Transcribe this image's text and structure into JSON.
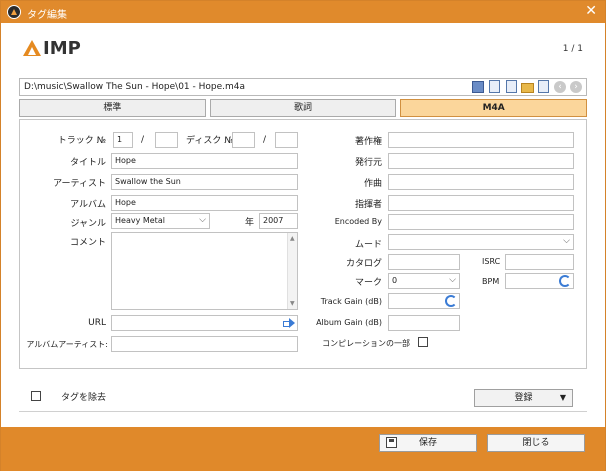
{
  "window": {
    "title": "タグ編集",
    "close_glyph": "✕"
  },
  "header": {
    "logo_text": "IMP",
    "page_count": "1 / 1"
  },
  "path": {
    "value": "D:\\music\\Swallow The Sun - Hope\\01 - Hope.m4a",
    "icons": [
      "tag-icon",
      "copy-icon",
      "paste-icon",
      "folder-icon",
      "save-icon",
      "prev-icon",
      "next-icon"
    ]
  },
  "tabs": [
    {
      "label": "標準"
    },
    {
      "label": "歌詞"
    },
    {
      "label": "M4A",
      "active": true
    }
  ],
  "left": {
    "track_label": "トラック №",
    "track_no": "1",
    "track_total": "",
    "slash": "/",
    "disc_label": "ディスク №",
    "disc_no": "",
    "disc_total": "",
    "title_label": "タイトル",
    "title": "Hope",
    "artist_label": "アーティスト",
    "artist": "Swallow the Sun",
    "album_label": "アルバム",
    "album": "Hope",
    "genre_label": "ジャンル",
    "genre": "Heavy Metal",
    "year_label": "年",
    "year": "2007",
    "comment_label": "コメント",
    "comment": "",
    "url_label": "URL",
    "url": "",
    "album_artist_label": "アルバムアーティスト:",
    "album_artist": ""
  },
  "right": {
    "copyright_label": "著作権",
    "publisher_label": "発行元",
    "composer_label": "作曲",
    "conductor_label": "指揮者",
    "encoded_by_label": "Encoded By",
    "mood_label": "ムード",
    "catalog_label": "カタログ",
    "isrc_label": "ISRC",
    "mark_label": "マーク",
    "mark": "0",
    "bpm_label": "BPM",
    "track_gain_label": "Track Gain (dB)",
    "album_gain_label": "Album Gain (dB)",
    "compilation_label": "コンピレーションの一部"
  },
  "bottom": {
    "remove_tags_label": "タグを除去",
    "register_label": "登録",
    "dropdown_glyph": "▼"
  },
  "footer": {
    "save_label": "保存",
    "close_label": "閉じる"
  },
  "colors": {
    "accent": "#e08a2c",
    "active_tab": "#fbd69b",
    "icon_blue": "#3a7bd5"
  }
}
